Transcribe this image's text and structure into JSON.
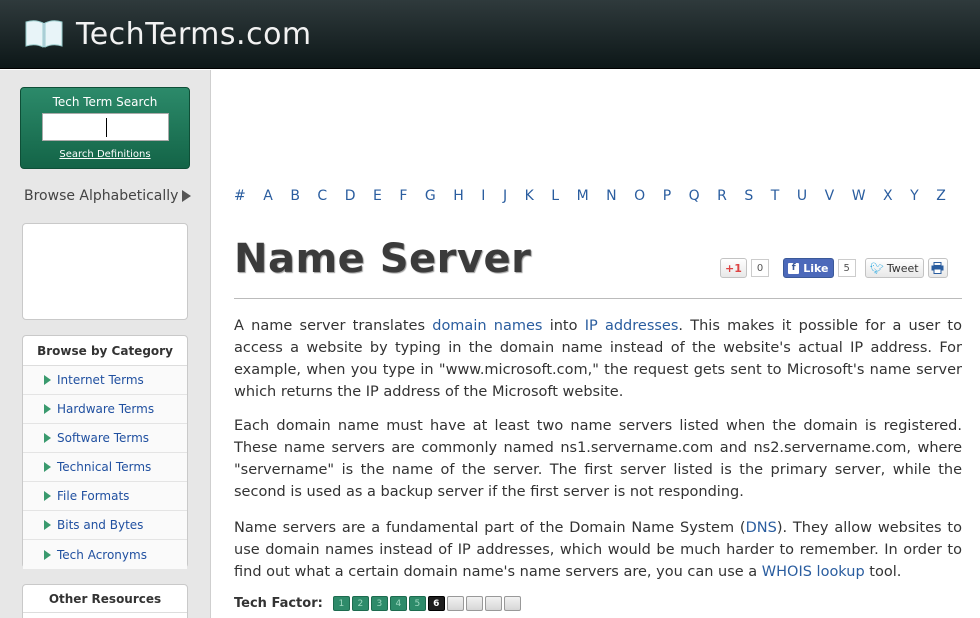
{
  "header": {
    "site_name": "TechTerms.com",
    "logo_icon": "open-book-icon"
  },
  "sidebar": {
    "search": {
      "title": "Tech Term Search",
      "input_value": "",
      "link_label": "Search Definitions"
    },
    "browse_alpha_label": "Browse Alphabetically",
    "category": {
      "heading": "Browse by Category",
      "items": [
        {
          "label": "Internet Terms"
        },
        {
          "label": "Hardware Terms"
        },
        {
          "label": "Software Terms"
        },
        {
          "label": "Technical Terms"
        },
        {
          "label": "File Formats"
        },
        {
          "label": "Bits and Bytes"
        },
        {
          "label": "Tech Acronyms"
        }
      ]
    },
    "other": {
      "heading": "Other Resources"
    }
  },
  "alpha_nav": [
    "#",
    "A",
    "B",
    "C",
    "D",
    "E",
    "F",
    "G",
    "H",
    "I",
    "J",
    "K",
    "L",
    "M",
    "N",
    "O",
    "P",
    "Q",
    "R",
    "S",
    "T",
    "U",
    "V",
    "W",
    "X",
    "Y",
    "Z"
  ],
  "main": {
    "title": "Name Server",
    "share": {
      "gplus_label": "+1",
      "gplus_count": "0",
      "fb_label": "Like",
      "fb_count": "5",
      "tweet_label": "Tweet"
    },
    "p1": {
      "t1": "A name server translates ",
      "l1": "domain names",
      "t2": " into ",
      "l2": "IP addresses",
      "t3": ". This makes it possible for a user to access a website by typing in the domain name instead of the website's actual IP address. For example, when you type in \"www.microsoft.com,\" the request gets sent to Microsoft's name server which returns the IP address of the Microsoft website."
    },
    "p2": "Each domain name must have at least two name servers listed when the domain is registered. These name servers are commonly named ns1.servername.com and ns2.servername.com, where \"servername\" is the name of the server. The first server listed is the primary server, while the second is used as a backup server if the first server is not responding.",
    "p3": {
      "t1": "Name servers are a fundamental part of the Domain Name System (",
      "l1": "DNS",
      "t2": "). They allow websites to use domain names instead of IP addresses, which would be much harder to remember. In order to find out what a certain domain name's name servers are, you can use a ",
      "l2": "WHOIS lookup",
      "t3": " tool."
    },
    "tech_factor": {
      "label": "Tech Factor:",
      "value": 6,
      "max": 10,
      "digits": [
        "1",
        "2",
        "3",
        "4",
        "5",
        "6",
        "",
        "",
        "",
        ""
      ]
    }
  },
  "colors": {
    "header_bg": "#1a2426",
    "accent_green": "#2e8b6a",
    "link_blue": "#2a5d9f"
  }
}
